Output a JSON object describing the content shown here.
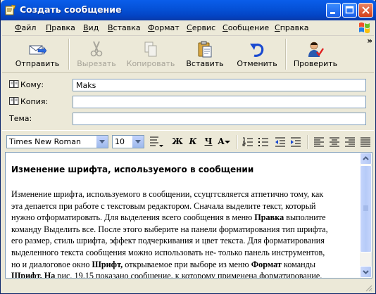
{
  "window": {
    "title": "Создать сообщение"
  },
  "menu": [
    {
      "label": "Файл",
      "u": "Ф",
      "rest": "айл"
    },
    {
      "label": "Правка",
      "u": "П",
      "rest": "равка"
    },
    {
      "label": "Вид",
      "u": "В",
      "rest": "ид"
    },
    {
      "label": "Вставка",
      "u": "В",
      "rest": "ставка"
    },
    {
      "label": "Формат",
      "u": "Ф",
      "rest": "ормат"
    },
    {
      "label": "Сервис",
      "u": "С",
      "rest": "ервис"
    },
    {
      "label": "Сообщение",
      "u": "С",
      "rest": "ообщение"
    },
    {
      "label": "Справка",
      "u": "С",
      "rest": "правка"
    }
  ],
  "toolbar": {
    "send": "Отправить",
    "cut": "Вырезать",
    "copy": "Копировать",
    "paste": "Вставить",
    "undo": "Отменить",
    "check": "Проверить",
    "more": "»"
  },
  "fields": {
    "to_label": "Кому:",
    "to_value": "Maks",
    "cc_label": "Копия:",
    "cc_value": "",
    "subject_label": "Тема:",
    "subject_value": ""
  },
  "format": {
    "font": "Times New Roman",
    "size": "10",
    "bold": "Ж",
    "italic": "К",
    "underline": "Ч",
    "color": "А"
  },
  "document": {
    "heading": "Изменение шрифта, используемого в сообщении",
    "p1": "Изменение шрифта, используемого в сообщении, ссуцггсвляется атпетично тому, как",
    "p2": "эта депается при работе с текстовым редактором. Сначала выделите текст, который",
    "p3a": "нужно отформатировать. Для выделения всего сообщения в меню ",
    "p3b": "Правка",
    "p3c": " выполните",
    "p4": "команду Выделить все. После этого выберите на панели форматирования тип шрифта,",
    "p5": "его размер, стиль шрифта, эффект подчеркивания и цвет текста. Для форматирования",
    "p6": "выделенного текста сообщения можно использовать не- только панель инструментов,",
    "p7a": "но и диалоговое окно ",
    "p7b": "Шрифт,",
    "p7c": " открываемое при выборе из меню ",
    "p7d": "Формат",
    "p7e": " команды",
    "p8a": "Шрифт. На",
    "p8b": " рис. 19.15 показано сообщение, к которому применена форматирование."
  },
  "colors": {
    "titlebar": "#0551D7",
    "chrome": "#ECE9D8",
    "border": "#7F9DB9"
  }
}
